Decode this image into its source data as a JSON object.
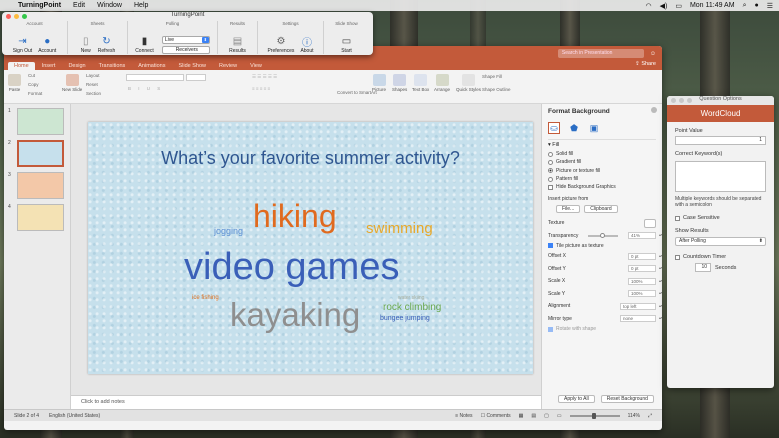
{
  "menubar": {
    "app_name": "TurningPoint",
    "menus": [
      "Edit",
      "Window",
      "Help"
    ],
    "clock": "Mon 11:49 AM"
  },
  "tp_toolbar": {
    "title": "TurningPoint",
    "groups": [
      {
        "title": "Account",
        "buttons": [
          {
            "label": "Sign Out",
            "icon": "sign-out-icon"
          },
          {
            "label": "Account",
            "icon": "account-icon"
          }
        ]
      },
      {
        "title": "Sheets",
        "buttons": [
          {
            "label": "New",
            "icon": "new-icon"
          },
          {
            "label": "Refresh",
            "icon": "refresh-icon"
          }
        ]
      },
      {
        "title": "Polling",
        "buttons": [
          {
            "label": "Connect",
            "icon": "connect-icon"
          }
        ],
        "mode_value": "Live",
        "receivers_label": "Receivers"
      },
      {
        "title": "Results",
        "buttons": [
          {
            "label": "Results",
            "icon": "results-icon"
          }
        ]
      },
      {
        "title": "Settings",
        "buttons": [
          {
            "label": "Preferences",
            "icon": "gear-icon"
          },
          {
            "label": "About",
            "icon": "info-icon"
          }
        ]
      },
      {
        "title": "Slide Show",
        "buttons": [
          {
            "label": "Start",
            "icon": "monitor-icon"
          }
        ]
      }
    ]
  },
  "ppt": {
    "search_placeholder": "Search in Presentation",
    "share_label": "Share",
    "tabs": [
      "Home",
      "Insert",
      "Design",
      "Transitions",
      "Animations",
      "Slide Show",
      "Review",
      "View"
    ],
    "active_tab": "Home",
    "ribbon": {
      "paste": "Paste",
      "cut": "Cut",
      "copy": "Copy",
      "format": "Format",
      "new_slide": "New Slide",
      "layout": "Layout",
      "reset": "Reset",
      "section": "Section",
      "convert": "Convert to SmartArt",
      "picture": "Picture",
      "shapes": "Shapes",
      "text_box": "Text Box",
      "arrange": "Arrange",
      "quick_styles": "Quick Styles",
      "shape_fill": "Shape Fill",
      "shape_outline": "Shape Outline"
    },
    "slide_numbers": [
      "1",
      "2",
      "3",
      "4"
    ],
    "slide": {
      "title": "What’s your favorite summer activity?",
      "words": [
        {
          "text": "hiking",
          "color": "#e06a1e"
        },
        {
          "text": "swimming",
          "color": "#e8a82a"
        },
        {
          "text": "jogging",
          "color": "#5b8fd4"
        },
        {
          "text": "video games",
          "color": "#3a5fb8"
        },
        {
          "text": "ice fishing",
          "color": "#e0701e"
        },
        {
          "text": "kayaking",
          "color": "#8f8f8f"
        },
        {
          "text": "water skiing",
          "color": "#a8b0a0"
        },
        {
          "text": "rock climbing",
          "color": "#6aa84f"
        },
        {
          "text": "bungee jumping",
          "color": "#3a5fb8"
        }
      ]
    },
    "notes_placeholder": "Click to add notes",
    "status": {
      "slide": "Slide 2 of 4",
      "language": "English (United States)",
      "notes": "Notes",
      "comments": "Comments",
      "zoom": "114%"
    }
  },
  "format_pane": {
    "title": "Format Background",
    "section": "Fill",
    "options": [
      {
        "label": "Solid fill",
        "selected": false
      },
      {
        "label": "Gradient fill",
        "selected": false
      },
      {
        "label": "Picture or texture fill",
        "selected": true
      },
      {
        "label": "Pattern fill",
        "selected": false
      }
    ],
    "hide_bg": "Hide Background Graphics",
    "insert_from": "Insert picture from",
    "file_btn": "File...",
    "clipboard_btn": "Clipboard",
    "texture_label": "Texture",
    "transparency_label": "Transparency",
    "transparency_value": "41%",
    "tile_label": "Tile picture as texture",
    "fields": [
      {
        "label": "Offset X",
        "value": "0 pt"
      },
      {
        "label": "Offset Y",
        "value": "0 pt"
      },
      {
        "label": "Scale X",
        "value": "100%"
      },
      {
        "label": "Scale Y",
        "value": "100%"
      },
      {
        "label": "Alignment",
        "value": "top left"
      },
      {
        "label": "Mirror type",
        "value": "none"
      }
    ],
    "rotate_label": "Rotate with shape",
    "apply_all": "Apply to All",
    "reset_bg": "Reset Background"
  },
  "question_options": {
    "title": "Question Options",
    "header": "WordCloud",
    "point_value_label": "Point Value",
    "point_value": "1",
    "correct_keywords_label": "Correct Keyword(s)",
    "hint": "Multiple keywords should be separated with a semicolon",
    "case_sensitive": "Case Sensitive",
    "show_results_label": "Show Results",
    "show_results_value": "After Polling",
    "countdown_label": "Countdown Timer",
    "countdown_value": "10",
    "seconds_label": "Seconds"
  },
  "colors": {
    "accent": "#c35a3a",
    "slide_bg": "#c6e0ec",
    "title": "#2f5690"
  }
}
